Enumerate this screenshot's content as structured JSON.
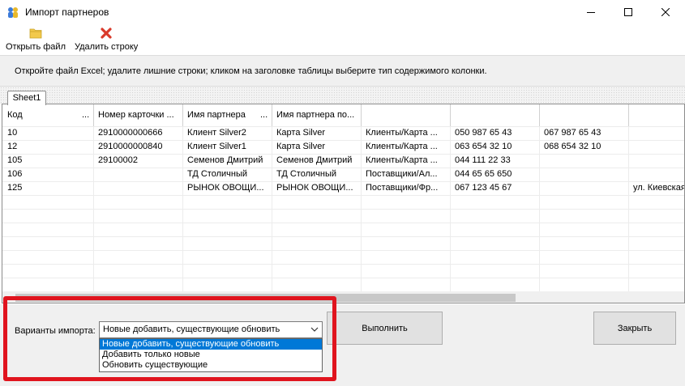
{
  "window": {
    "title": "Импорт партнеров",
    "icons": {
      "app": "partners-icon",
      "minimize": "minimize-icon",
      "maximize": "maximize-icon",
      "close": "close-icon"
    }
  },
  "toolbar": {
    "open_label": "Открыть файл",
    "open_icon": "folder-icon",
    "delete_label": "Удалить строку",
    "delete_icon": "red-x-icon"
  },
  "instruction": "Откройте файл Excel;  удалите лишние строки;  кликом на заголовке таблицы выберите тип содержимого колонки.",
  "tabs": [
    {
      "label": "Sheet1"
    }
  ],
  "grid": {
    "columns": [
      {
        "label": "Код",
        "dots": "..."
      },
      {
        "label": "Номер карточки ...",
        "dots": ""
      },
      {
        "label": "Имя партнера",
        "dots": "..."
      },
      {
        "label": "Имя партнера по...",
        "dots": ""
      },
      {
        "label": "",
        "dots": ""
      },
      {
        "label": "",
        "dots": ""
      },
      {
        "label": "",
        "dots": ""
      },
      {
        "label": "",
        "dots": ""
      }
    ],
    "rows": [
      [
        "10",
        "2910000000666",
        "Клиент Silver2",
        "Карта Silver",
        "Клиенты/Карта ...",
        "050 987 65 43",
        "067 987 65 43",
        ""
      ],
      [
        "12",
        "2910000000840",
        "Клиент Silver1",
        "Карта Silver",
        "Клиенты/Карта ...",
        "063 654 32 10",
        "068 654 32 10",
        ""
      ],
      [
        "105",
        "29100002",
        "Семенов Дмитрий",
        "Семенов Дмитрий",
        "Клиенты/Карта ...",
        "044 111 22 33",
        "",
        ""
      ],
      [
        "106",
        "",
        "ТД Столичный",
        "ТД Столичный",
        "Поставщики/Ал...",
        "044 65 65 650",
        "",
        ""
      ],
      [
        "125",
        "",
        "РЫНОК ОВОЩИ...",
        "РЫНОК ОВОЩИ...",
        "Поставщики/Фр...",
        "067 123 45 67",
        "",
        "ул. Киевская"
      ]
    ]
  },
  "import": {
    "label": "Варианты импорта:",
    "selected": "Новые добавить, существующие обновить",
    "options": [
      "Новые добавить, существующие обновить",
      "Добавить только новые",
      "Обновить существующие"
    ]
  },
  "buttons": {
    "execute": "Выполнить",
    "close": "Закрыть"
  },
  "colors": {
    "highlight": "#e0141e",
    "selection": "#0078d7",
    "panel": "#f0f0f0",
    "button": "#e1e1e1"
  }
}
